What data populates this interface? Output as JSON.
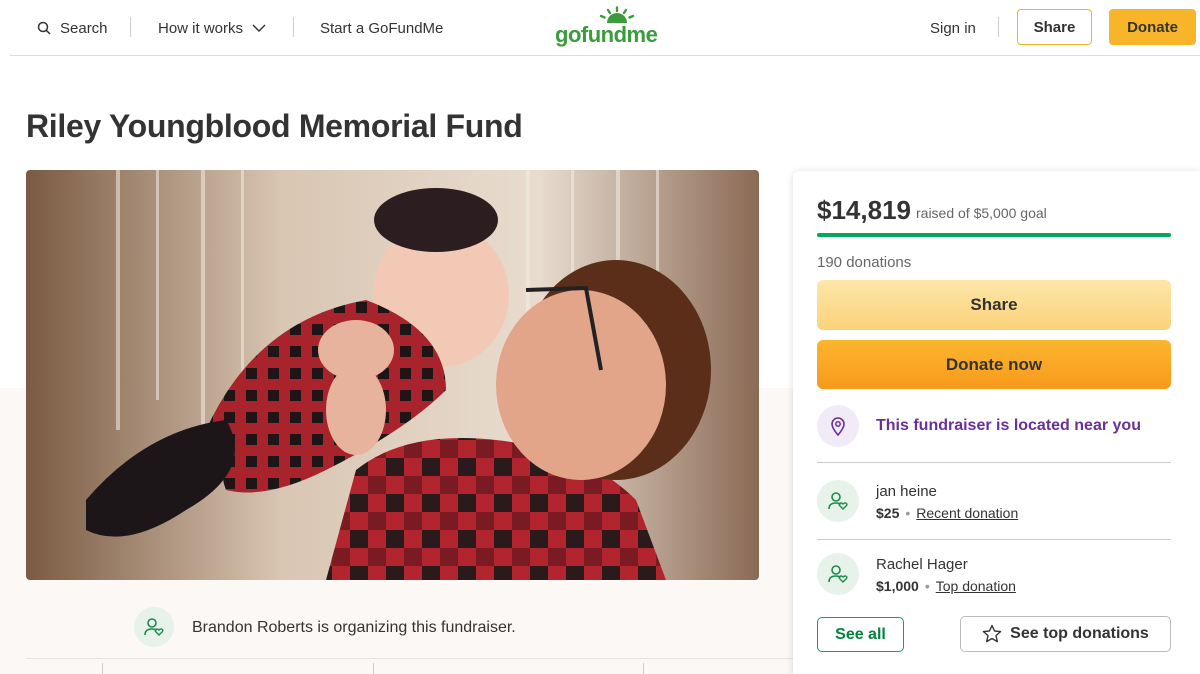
{
  "nav": {
    "search_label": "Search",
    "how_it_works_label": "How it works",
    "start_label": "Start a GoFundMe",
    "logo_text": "gofundme",
    "signin_label": "Sign in",
    "share_label": "Share",
    "donate_label": "Donate"
  },
  "campaign": {
    "title": "Riley Youngblood Memorial Fund",
    "organizer_text": "Brandon Roberts is organizing this fundraiser."
  },
  "card": {
    "raised": "$14,819",
    "goal_text": "raised of $5,000 goal",
    "progress_fraction": 1.0,
    "donations_count": "190 donations",
    "share_label": "Share",
    "donate_label": "Donate now",
    "location_text": "This fundraiser is located near you",
    "donors": [
      {
        "name": "jan heine",
        "amount": "$25",
        "tag": "Recent donation"
      },
      {
        "name": "Rachel Hager",
        "amount": "$1,000",
        "tag": "Top donation"
      }
    ],
    "see_all_label": "See all",
    "see_top_label": "See top donations"
  },
  "colors": {
    "accent_green": "#02a95c",
    "donate_yellow": "#f8b52a",
    "location_purple": "#6b2f9a"
  }
}
